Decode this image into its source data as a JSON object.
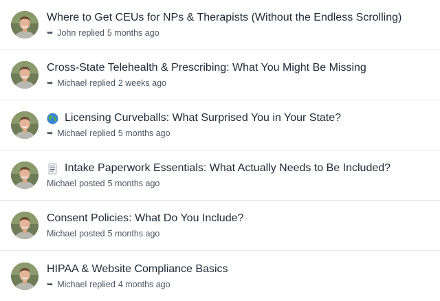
{
  "threads": [
    {
      "title": "Where to Get CEUs for NPs & Therapists (Without the Endless Scrolling)",
      "emoji": "",
      "author": "John",
      "action": "replied",
      "time": "5 months ago",
      "show_reply_icon": true
    },
    {
      "title": "Cross-State Telehealth & Prescribing: What You Might Be Missing",
      "emoji": "",
      "author": "Michael",
      "action": "replied",
      "time": "2 weeks ago",
      "show_reply_icon": true
    },
    {
      "title": "Licensing Curveballs: What Surprised You in Your State?",
      "emoji": "globe",
      "author": "Michael",
      "action": "replied",
      "time": "5 months ago",
      "show_reply_icon": true
    },
    {
      "title": "Intake Paperwork Essentials: What Actually Needs to Be Included?",
      "emoji": "page",
      "author": "Michael",
      "action": "posted",
      "time": "5 months ago",
      "show_reply_icon": false
    },
    {
      "title": "Consent Policies: What Do You Include?",
      "emoji": "",
      "author": "Michael",
      "action": "posted",
      "time": "5 months ago",
      "show_reply_icon": false
    },
    {
      "title": "HIPAA & Website Compliance Basics",
      "emoji": "",
      "author": "Michael",
      "action": "replied",
      "time": "4 months ago",
      "show_reply_icon": true
    }
  ],
  "icons": {
    "reply": "reply-arrow-icon",
    "avatar": "avatar"
  }
}
